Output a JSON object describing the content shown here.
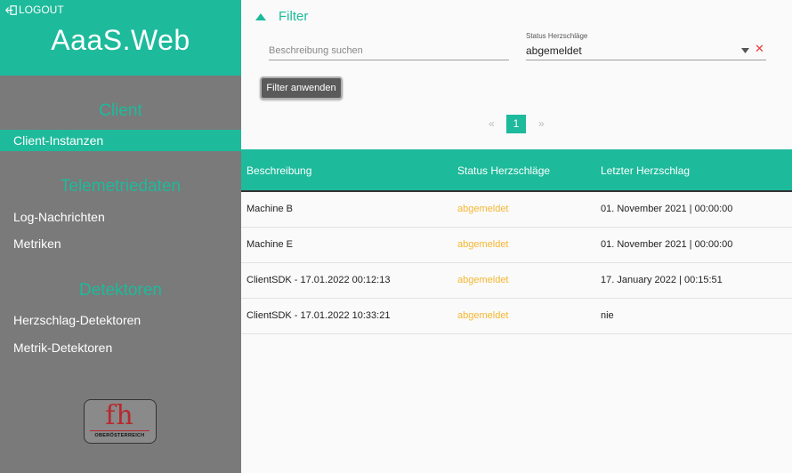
{
  "sidebar": {
    "logout_label": "LOGOUT",
    "brand_title": "AaaS.Web",
    "sections": [
      {
        "title": "Client",
        "items": [
          {
            "label": "Client-Instanzen",
            "active": true
          }
        ]
      },
      {
        "title": "Telemetriedaten",
        "items": [
          {
            "label": "Log-Nachrichten"
          },
          {
            "label": "Metriken"
          }
        ]
      },
      {
        "title": "Detektoren",
        "items": [
          {
            "label": "Herzschlag-Detektoren"
          },
          {
            "label": "Metrik-Detektoren"
          }
        ]
      }
    ],
    "logo": {
      "mark": "fh",
      "subtitle": "OBERÖSTERREICH"
    }
  },
  "filter": {
    "label": "Filter",
    "search": {
      "placeholder": "Beschreibung suchen",
      "value": ""
    },
    "status": {
      "caption": "Status Herzschläge",
      "value": "abgemeldet"
    },
    "apply_label": "Filter anwenden"
  },
  "pagination": {
    "prev": "«",
    "current": "1",
    "next": "»"
  },
  "table": {
    "columns": [
      "Beschreibung",
      "Status Herzschläge",
      "Letzter Herzschlag"
    ],
    "rows": [
      {
        "description": "Machine B",
        "status": "abgemeldet",
        "last": "01. November 2021 | 00:00:00"
      },
      {
        "description": "Machine E",
        "status": "abgemeldet",
        "last": "01. November 2021 | 00:00:00"
      },
      {
        "description": "ClientSDK - 17.01.2022 00:12:13",
        "status": "abgemeldet",
        "last": "17. January 2022 | 00:15:51"
      },
      {
        "description": "ClientSDK - 17.01.2022 10:33:21",
        "status": "abgemeldet",
        "last": "nie"
      }
    ]
  },
  "colors": {
    "accent": "#1dba9b",
    "sidebar_bg": "#7a7a7a",
    "status_warning": "#f5b731",
    "clear": "#e53935"
  }
}
